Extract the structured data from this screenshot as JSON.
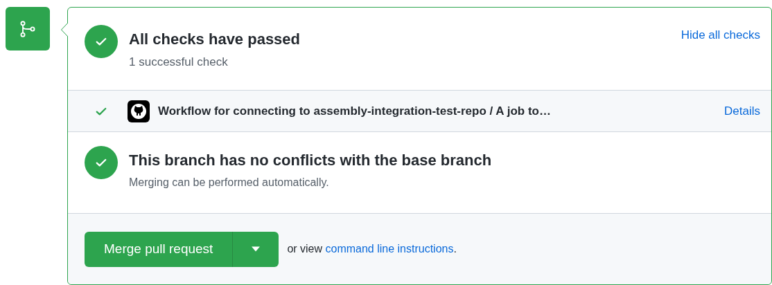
{
  "summary": {
    "passed": true,
    "title": "All checks have passed",
    "subtitle": "1 successful check",
    "toggle_link": "Hide all checks"
  },
  "checks": [
    {
      "passed": true,
      "name": "Workflow for connecting to assembly-integration-test-repo / A job to…",
      "link": "Details"
    }
  ],
  "branch": {
    "passed": true,
    "title": "This branch has no conflicts with the base branch",
    "subtitle": "Merging can be performed automatically."
  },
  "merge": {
    "button": "Merge pull request",
    "hint_prefix": "or view ",
    "hint_link": "command line instructions",
    "hint_suffix": "."
  }
}
